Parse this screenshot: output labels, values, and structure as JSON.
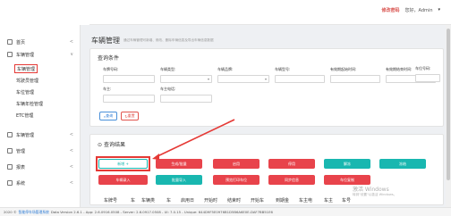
{
  "header": {
    "change_pwd": "修改密码",
    "welcome": "您好，Admin",
    "dropdown": "▾"
  },
  "sidebar": {
    "items": [
      {
        "label": "首页",
        "arrow": "<"
      },
      {
        "label": "车辆管理",
        "arrow": "∨"
      },
      {
        "label": "车辆管理"
      },
      {
        "label": "驾驶员管理"
      },
      {
        "label": "车位管理"
      },
      {
        "label": "车辆年检管理"
      },
      {
        "label": "ETC管理"
      },
      {
        "label": "车辆管理",
        "arrow": "<"
      },
      {
        "label": "管理",
        "arrow": "<"
      },
      {
        "label": "报表",
        "arrow": "<"
      },
      {
        "label": "系统",
        "arrow": "<"
      }
    ]
  },
  "page": {
    "title": "车辆管理",
    "desc": "通过车辆管理可新增、修改、删除车辆信息及导出车辆信息数据"
  },
  "query": {
    "title": "查询条件",
    "labels": [
      "车牌号码:",
      "车辆类型:",
      "车辆品牌:",
      "车辆型号:",
      "有效期起始时间:",
      "有效期结束时间:",
      "车位号码:",
      "车主:",
      "车主电话:"
    ],
    "search_btn": "查询",
    "reset_btn": "重置"
  },
  "results": {
    "title": "查询结果",
    "buttons_row1": [
      "新增 +",
      "生成/批量",
      "启用",
      "停用",
      "解冻",
      "冻结"
    ],
    "buttons_row2": [
      "车辆录入",
      "批量导入",
      "预览打印车位",
      "同步信息",
      "车位复制"
    ],
    "columns": [
      "车牌号",
      "车",
      "车辆类",
      "车",
      "启用日",
      "开始时",
      "结束时",
      "开始车",
      "到期金",
      "车主电",
      "车主",
      "车号"
    ]
  },
  "footer": {
    "prefix": "2020 ©",
    "link": "智能停车场管理系统",
    "version": "Data Version 2.6.1 - App: 2.6.0916.0508 - Server: 2.6.0917.0508 - UI: 7.0.15 - Unique: 644D9F5E0976B1D5B6A6E0E-DAF7BB51E6"
  },
  "watermark": {
    "line1": "激活 Windows",
    "line2": "转到\"设置\"以激活 Windows。"
  }
}
